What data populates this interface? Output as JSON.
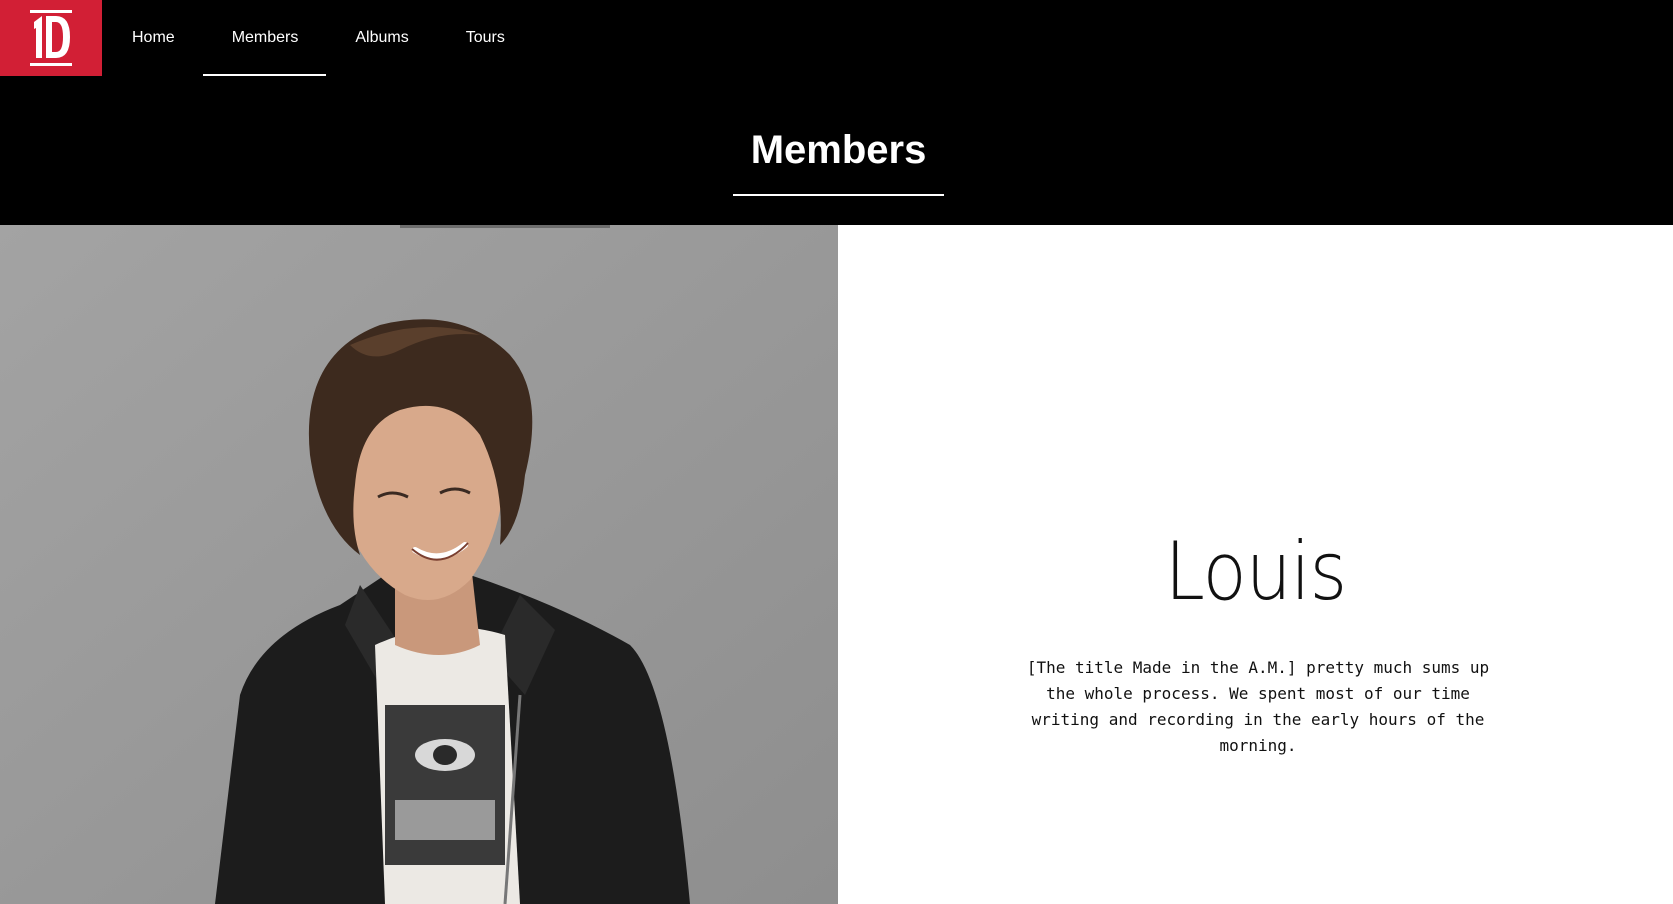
{
  "logo": {
    "text": "1D",
    "background": "#d21f35"
  },
  "nav": {
    "items": [
      {
        "label": "Home"
      },
      {
        "label": "Members",
        "active": true
      },
      {
        "label": "Albums"
      },
      {
        "label": "Tours"
      }
    ]
  },
  "section": {
    "title": "Members"
  },
  "member": {
    "name": "Louis",
    "quote": "[The title Made in the A.M.] pretty much sums up the whole process. We spent most of our time writing and recording in the early hours of the morning."
  },
  "colors": {
    "header_bg": "#000000",
    "accent": "#d21f35",
    "photo_bg": "#9a9a9a",
    "content_bg": "#ffffff"
  }
}
